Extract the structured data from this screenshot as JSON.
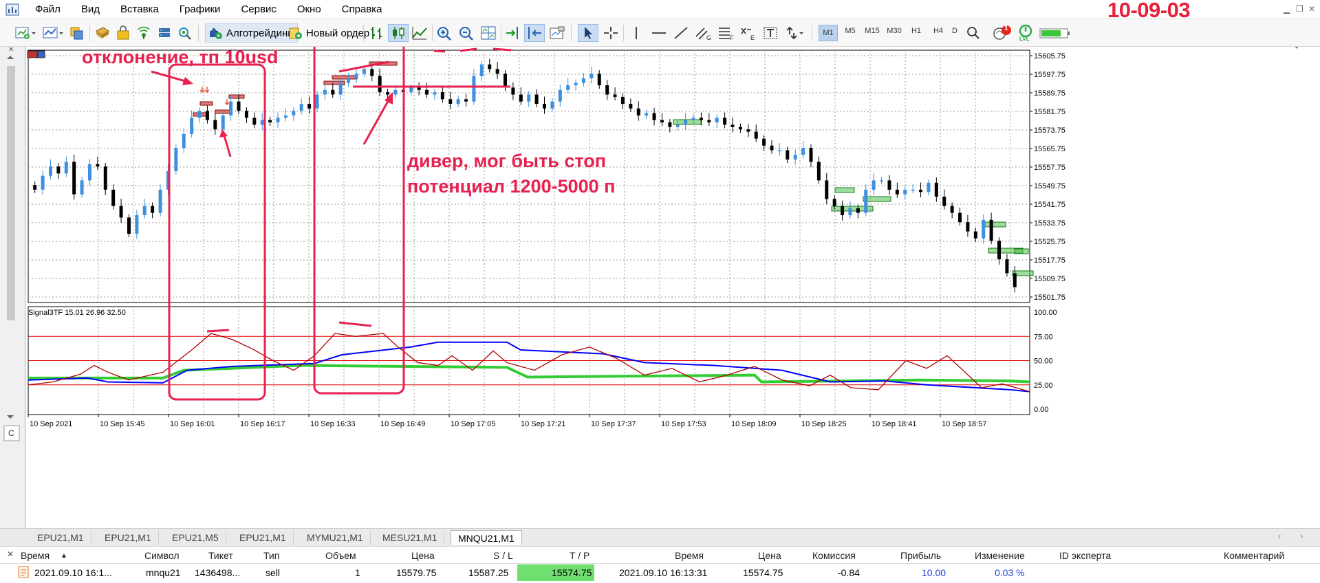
{
  "stamp": "10-09-03",
  "menu": [
    "Файл",
    "Вид",
    "Вставка",
    "Графики",
    "Сервис",
    "Окно",
    "Справка"
  ],
  "toolbar": {
    "algo_label": "Алготрейдинг",
    "new_order_label": "Новый ордер",
    "timeframes": [
      "M1",
      "M5",
      "M15",
      "M30",
      "H1",
      "H4",
      "D"
    ],
    "active_timeframe": "M1",
    "notification_count": "1",
    "lvl_label": "LVL"
  },
  "annotations": {
    "deviation": "отклонение, тп 10usd",
    "divergence_line1": "дивер, мог быть стоп",
    "divergence_line2": "потенциал 1200-5000 п"
  },
  "indicator": {
    "label": "Signal3TF 15.01 26.96 32.50",
    "levels": [
      "100.00",
      "75.00",
      "50.00",
      "25.00",
      "0.00"
    ]
  },
  "price_axis": [
    "15605.75",
    "15597.75",
    "15589.75",
    "15581.75",
    "15573.75",
    "15565.75",
    "15557.75",
    "15549.75",
    "15541.75",
    "15533.75",
    "15525.75",
    "15517.75",
    "15509.75",
    "15501.75"
  ],
  "time_axis": [
    "10 Sep 2021",
    "10 Sep 15:45",
    "10 Sep 16:01",
    "10 Sep 16:17",
    "10 Sep 16:33",
    "10 Sep 16:49",
    "10 Sep 17:05",
    "10 Sep 17:21",
    "10 Sep 17:37",
    "10 Sep 17:53",
    "10 Sep 18:09",
    "10 Sep 18:25",
    "10 Sep 18:41",
    "10 Sep 18:57"
  ],
  "chart_tabs": [
    "EPU21,M1",
    "EPU21,M1",
    "EPU21,M5",
    "EPU21,M1",
    "MYMU21,M1",
    "MESU21,M1",
    "MNQU21,M1"
  ],
  "active_chart_tab": "MNQU21,M1",
  "trade_table": {
    "headers": [
      "Время",
      "Символ",
      "Тикет",
      "Тип",
      "Объем",
      "Цена",
      "S / L",
      "T / P",
      "Время",
      "Цена",
      "Комиссия",
      "Прибыль",
      "Изменение",
      "ID эксперта",
      "Комментарий"
    ],
    "row": [
      "2021.09.10 16:1...",
      "mnqu21",
      "1436498...",
      "sell",
      "1",
      "15579.75",
      "15587.25",
      "15574.75",
      "2021.09.10 16:13:31",
      "15574.75",
      "-0.84",
      "10.00",
      "0.03 %",
      "",
      ""
    ]
  },
  "colors": {
    "bull_candle": "#3d8fe0",
    "bear_candle": "#000000",
    "annotation": "#e8204f",
    "line_blue": "#0000ff",
    "line_green": "#33cc33",
    "line_red": "#b00000",
    "tp_green": "#6fe06f"
  },
  "chart_data": {
    "type": "line",
    "title": "MNQU21,M1",
    "ylim_price": [
      15501.75,
      15605.75
    ],
    "ylim_indicator": [
      0,
      100
    ],
    "indicator_levels": [
      25,
      50,
      75
    ],
    "close_series": [
      15548,
      15554,
      15558,
      15555,
      15560,
      15546,
      15552,
      15559,
      15558,
      15548,
      15541,
      15536,
      15529,
      15537,
      15541,
      15538,
      15548,
      15556,
      15566,
      15572,
      15579,
      15582,
      15578,
      15574,
      15580,
      15586,
      15582,
      15579,
      15576,
      15578,
      15577,
      15579,
      15580,
      15582,
      15585,
      15583,
      15589,
      15591,
      15589,
      15594,
      15596,
      15598,
      15600,
      15597,
      15590,
      15589,
      15591,
      15590,
      15592,
      15591,
      15589,
      15590,
      15587,
      15585,
      15587,
      15586,
      15597,
      15602,
      15600,
      15598,
      15592,
      15589,
      15586,
      15589,
      15585,
      15583,
      15586,
      15591,
      15593,
      15594,
      15596,
      15598,
      15593,
      15589,
      15588,
      15585,
      15583,
      15580,
      15581,
      15578,
      15577,
      15575,
      15576,
      15578,
      15579,
      15578,
      15577,
      15579,
      15576,
      15575,
      15574,
      15573,
      15570,
      15567,
      15565,
      15565,
      15561,
      15563,
      15566,
      15560,
      15552,
      15544,
      15541,
      15537,
      15540,
      15538,
      15548,
      15552,
      15552,
      15548,
      15546,
      15548,
      15548,
      15547,
      15551,
      15545,
      15541,
      15538,
      15534,
      15530,
      15527,
      15535,
      15526,
      15518,
      15512,
      15506
    ]
  }
}
